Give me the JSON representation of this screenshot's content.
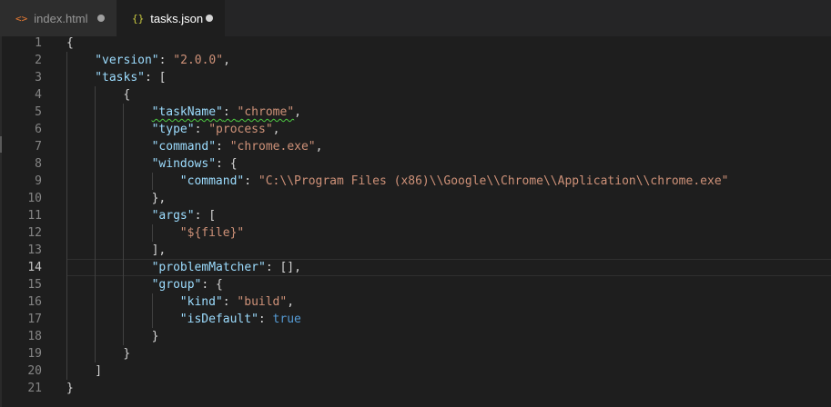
{
  "tabs": [
    {
      "icon": "<>",
      "label": "index.html",
      "active": false
    },
    {
      "icon": "{}",
      "label": "tasks.json",
      "active": true
    }
  ],
  "editor": {
    "current_line": 14,
    "lines": [
      {
        "n": "1",
        "ind": 0,
        "t": [
          [
            "pun",
            "{"
          ]
        ]
      },
      {
        "n": "2",
        "ind": 1,
        "t": [
          [
            "key",
            "\"version\""
          ],
          [
            "pun",
            ": "
          ],
          [
            "str",
            "\"2.0.0\""
          ],
          [
            "pun",
            ","
          ]
        ]
      },
      {
        "n": "3",
        "ind": 1,
        "t": [
          [
            "key",
            "\"tasks\""
          ],
          [
            "pun",
            ": ["
          ]
        ]
      },
      {
        "n": "4",
        "ind": 2,
        "t": [
          [
            "pun",
            "{"
          ]
        ]
      },
      {
        "n": "5",
        "ind": 3,
        "t": [
          [
            "key squig",
            "\"taskName\""
          ],
          [
            "pun squig",
            ": "
          ],
          [
            "str squig",
            "\"chrome\""
          ],
          [
            "pun",
            ","
          ]
        ]
      },
      {
        "n": "6",
        "ind": 3,
        "t": [
          [
            "key",
            "\"type\""
          ],
          [
            "pun",
            ": "
          ],
          [
            "str",
            "\"process\""
          ],
          [
            "pun",
            ","
          ]
        ]
      },
      {
        "n": "7",
        "ind": 3,
        "t": [
          [
            "key",
            "\"command\""
          ],
          [
            "pun",
            ": "
          ],
          [
            "str",
            "\"chrome.exe\""
          ],
          [
            "pun",
            ","
          ]
        ]
      },
      {
        "n": "8",
        "ind": 3,
        "t": [
          [
            "key",
            "\"windows\""
          ],
          [
            "pun",
            ": {"
          ]
        ]
      },
      {
        "n": "9",
        "ind": 4,
        "t": [
          [
            "key",
            "\"command\""
          ],
          [
            "pun",
            ": "
          ],
          [
            "str",
            "\"C:\\\\Program Files (x86)\\\\Google\\\\Chrome\\\\Application\\\\chrome.exe\""
          ]
        ]
      },
      {
        "n": "10",
        "ind": 3,
        "t": [
          [
            "pun",
            "},"
          ]
        ]
      },
      {
        "n": "11",
        "ind": 3,
        "t": [
          [
            "key",
            "\"args\""
          ],
          [
            "pun",
            ": ["
          ]
        ]
      },
      {
        "n": "12",
        "ind": 4,
        "t": [
          [
            "str",
            "\"${file}\""
          ]
        ]
      },
      {
        "n": "13",
        "ind": 3,
        "t": [
          [
            "pun",
            "],"
          ]
        ]
      },
      {
        "n": "14",
        "ind": 3,
        "t": [
          [
            "key",
            "\"problemMatcher\""
          ],
          [
            "pun",
            ": [],"
          ]
        ]
      },
      {
        "n": "15",
        "ind": 3,
        "t": [
          [
            "key",
            "\"group\""
          ],
          [
            "pun",
            ": {"
          ]
        ]
      },
      {
        "n": "16",
        "ind": 4,
        "t": [
          [
            "key",
            "\"kind\""
          ],
          [
            "pun",
            ": "
          ],
          [
            "str",
            "\"build\""
          ],
          [
            "pun",
            ","
          ]
        ]
      },
      {
        "n": "17",
        "ind": 4,
        "t": [
          [
            "key",
            "\"isDefault\""
          ],
          [
            "pun",
            ": "
          ],
          [
            "kw",
            "true"
          ]
        ]
      },
      {
        "n": "18",
        "ind": 3,
        "t": [
          [
            "pun",
            "}"
          ]
        ]
      },
      {
        "n": "19",
        "ind": 2,
        "t": [
          [
            "pun",
            "}"
          ]
        ]
      },
      {
        "n": "20",
        "ind": 1,
        "t": [
          [
            "pun",
            "]"
          ]
        ]
      },
      {
        "n": "21",
        "ind": 0,
        "t": [
          [
            "pun",
            "}"
          ]
        ]
      }
    ]
  }
}
